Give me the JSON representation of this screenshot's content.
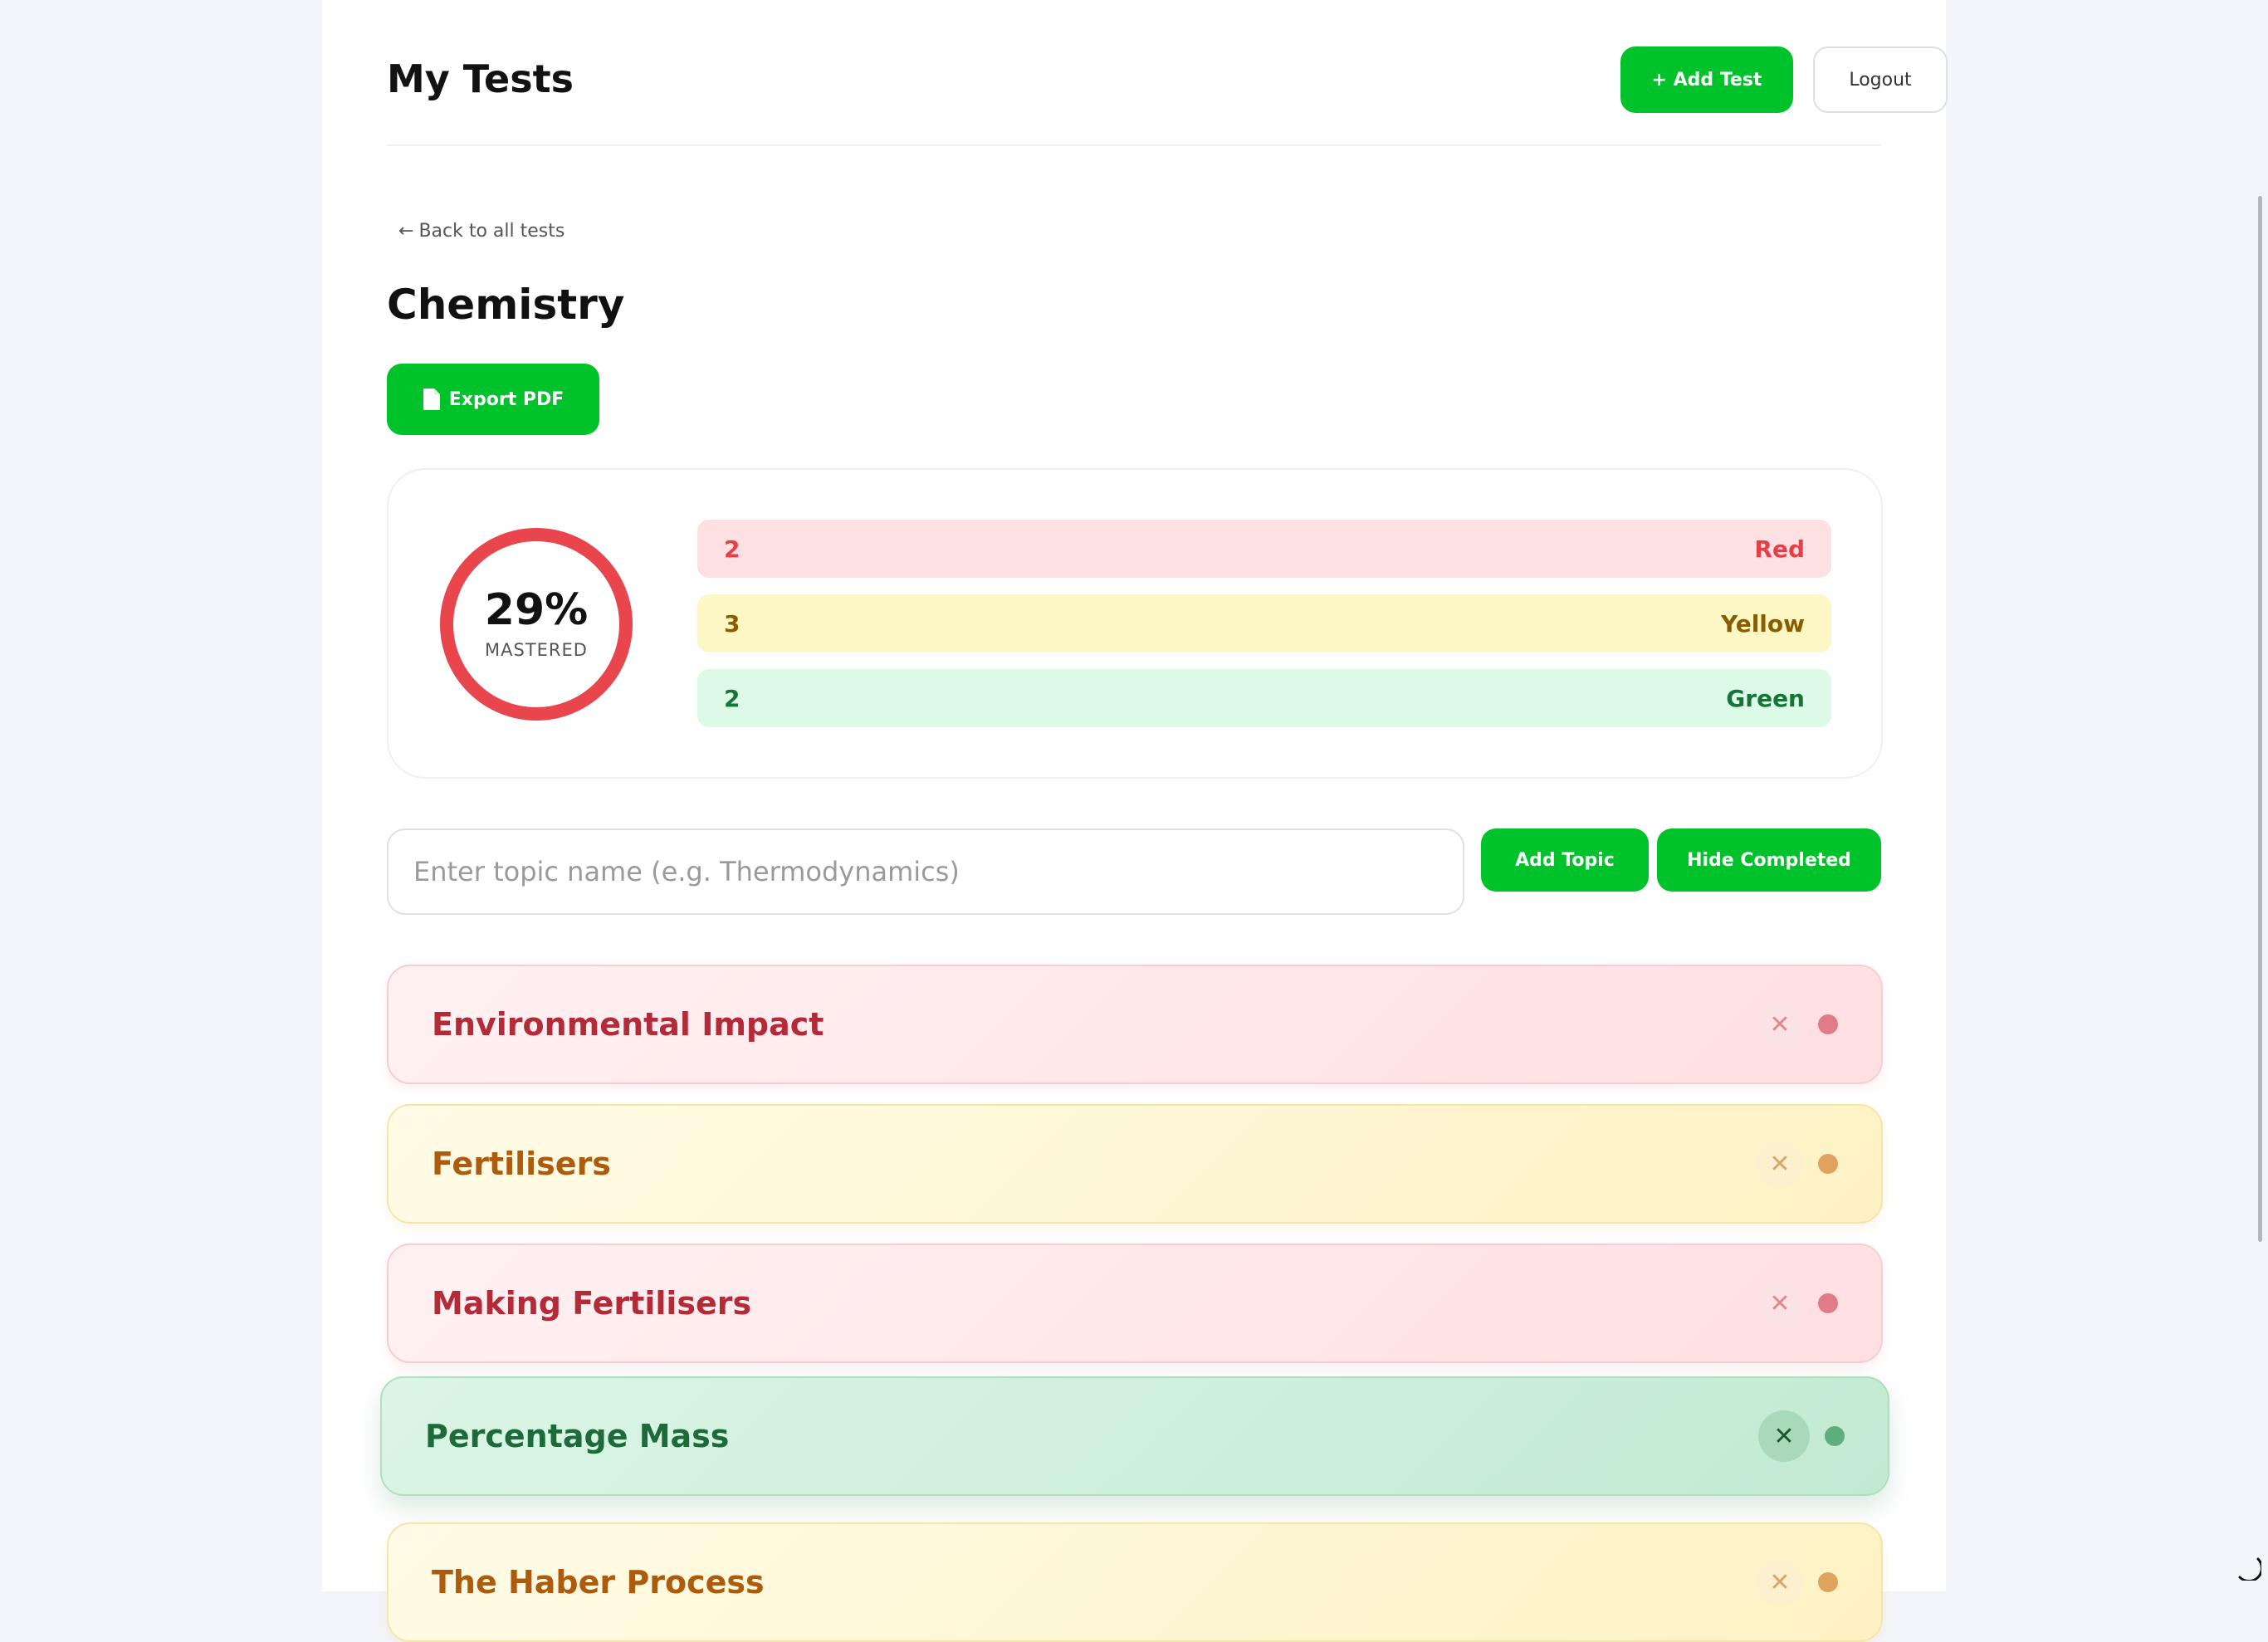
{
  "header": {
    "title": "My Tests",
    "add_test_label": "+ Add Test",
    "logout_label": "Logout"
  },
  "nav": {
    "back_label": "Back to all tests"
  },
  "subject": {
    "title": "Chemistry",
    "export_label": "Export PDF"
  },
  "stats": {
    "mastered_percent": "29%",
    "mastered_fraction": 0.29,
    "mastered_label": "MASTERED",
    "ring_color": "#e9454d",
    "bars": [
      {
        "count": "2",
        "label": "Red"
      },
      {
        "count": "3",
        "label": "Yellow"
      },
      {
        "count": "2",
        "label": "Green"
      }
    ]
  },
  "controls": {
    "topic_placeholder": "Enter topic name (e.g. Thermodynamics)",
    "add_topic_label": "Add Topic",
    "hide_completed_label": "Hide Completed"
  },
  "topics": [
    {
      "name": "Environmental Impact",
      "status": "red"
    },
    {
      "name": "Fertilisers",
      "status": "yellow"
    },
    {
      "name": "Making Fertilisers",
      "status": "red"
    },
    {
      "name": "Percentage Mass",
      "status": "green"
    },
    {
      "name": "The Haber Process",
      "status": "yellow"
    }
  ],
  "icons": {
    "back": "left-arrow-icon",
    "export": "document-icon",
    "delete": "close-icon",
    "status": "status-dot-icon"
  },
  "colors": {
    "accent": "#00c22a",
    "red": "#e4404a",
    "yellow": "#8a5c00",
    "green": "#16733a"
  }
}
